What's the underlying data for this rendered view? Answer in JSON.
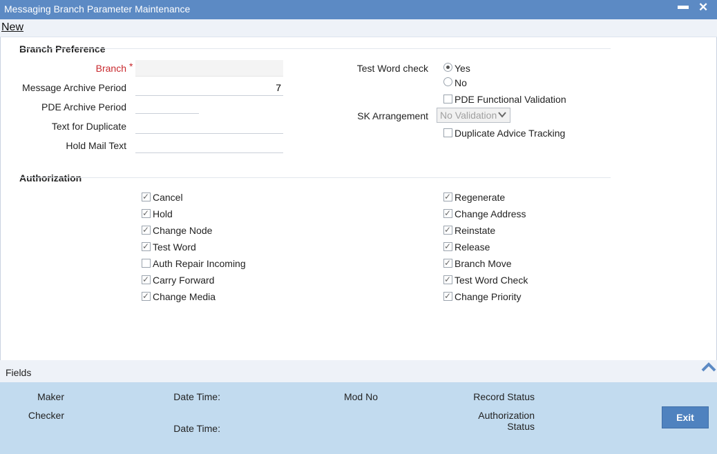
{
  "window": {
    "title": "Messaging Branch Parameter Maintenance",
    "minimize": "▬",
    "close": "✕"
  },
  "toolbar": {
    "new_label": "New"
  },
  "branch_preference": {
    "title": "Branch Preference",
    "branch_label": "Branch",
    "required_mark": "*",
    "branch_value": "",
    "message_archive_label": "Message Archive Period",
    "message_archive_value": "7",
    "pde_archive_label": "PDE Archive Period",
    "pde_archive_value": "",
    "text_duplicate_label": "Text for Duplicate",
    "text_duplicate_value": "",
    "hold_mail_label": "Hold Mail Text",
    "hold_mail_value": "",
    "test_word_check_label": "Test Word check",
    "test_word_yes": "Yes",
    "test_word_no": "No",
    "test_word_selected": "Yes",
    "pde_functional_validation": {
      "label": "PDE Functional Validation",
      "checked": false
    },
    "sk_arrangement_label": "SK Arrangement",
    "sk_arrangement_value": "No Validation",
    "duplicate_advice_tracking": {
      "label": "Duplicate Advice Tracking",
      "checked": false
    }
  },
  "authorization": {
    "title": "Authorization",
    "left": [
      {
        "label": "Cancel",
        "checked": true
      },
      {
        "label": "Hold",
        "checked": true
      },
      {
        "label": "Change Node",
        "checked": true
      },
      {
        "label": "Test Word",
        "checked": true
      },
      {
        "label": "Auth Repair Incoming",
        "checked": false
      },
      {
        "label": "Carry Forward",
        "checked": true
      },
      {
        "label": "Change Media",
        "checked": true
      }
    ],
    "right": [
      {
        "label": "Regenerate",
        "checked": true
      },
      {
        "label": "Change Address",
        "checked": true
      },
      {
        "label": "Reinstate",
        "checked": true
      },
      {
        "label": "Release",
        "checked": true
      },
      {
        "label": "Branch Move",
        "checked": true
      },
      {
        "label": "Test Word Check",
        "checked": true
      },
      {
        "label": "Change Priority",
        "checked": true
      }
    ]
  },
  "fields_bar": {
    "label": "Fields"
  },
  "footer": {
    "maker": "Maker",
    "checker": "Checker",
    "date_time_1": "Date Time:",
    "date_time_2": "Date Time:",
    "mod_no": "Mod No",
    "record_status": "Record Status",
    "authorization_status_line1": "Authorization",
    "authorization_status_line2": "Status",
    "exit_label": "Exit"
  },
  "colors": {
    "titlebar": "#5c8ac4",
    "footer": "#c2dbef",
    "exit_button": "#4f82bf",
    "required": "#c8282d"
  }
}
